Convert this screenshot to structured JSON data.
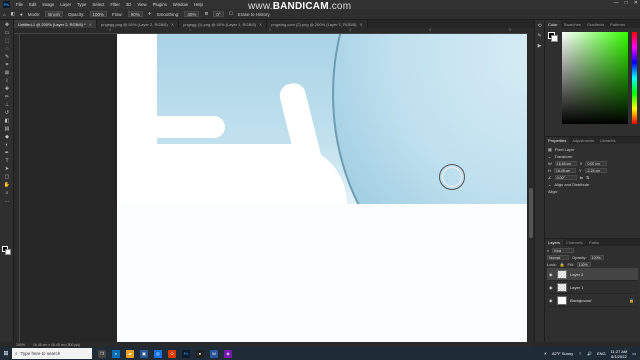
{
  "menubar": {
    "logo": "Ps",
    "items": [
      "File",
      "Edit",
      "Image",
      "Layer",
      "Type",
      "Select",
      "Filter",
      "3D",
      "View",
      "Plugins",
      "Window",
      "Help"
    ],
    "window_controls": [
      "—",
      "□",
      "✕"
    ]
  },
  "watermark": {
    "prefix": "www.",
    "brand": "BANDICAM",
    "suffix": ".com"
  },
  "options_bar": {
    "mode_label": "Mode:",
    "mode_value": "Brush",
    "opacity_label": "Opacity:",
    "opacity_value": "100%",
    "flow_label": "Flow:",
    "flow_value": "90%",
    "smoothing_label": "Smoothing:",
    "smoothing_value": "40%",
    "angle_value": "0°",
    "erase_history": "Erase to History"
  },
  "tabs": [
    {
      "label": "Untitled-1 @ 200% (Layer 2, RGB/8) *",
      "active": true
    },
    {
      "label": "pngegg.png @ 50% (Layer 2, RGB/8)",
      "active": false
    },
    {
      "label": "pngegg (1).png @ 50% (Layer 1, RGB/8)",
      "active": false
    },
    {
      "label": "pngwing.com (2).png @ 200% (Layer 1, RGB/8)",
      "active": false
    }
  ],
  "ruler_ticks": [
    "0",
    "1",
    "2",
    "3",
    "4",
    "5"
  ],
  "statusbar": {
    "zoom": "200%",
    "doc": "16.45 cm x 16.45 cm (300 ppi)"
  },
  "panels": {
    "color_tabs": [
      "Color",
      "Swatches",
      "Gradients",
      "Patterns"
    ],
    "colors": {
      "accent": "#31a8ff",
      "fg": "#000000",
      "bg": "#ffffff",
      "picker_hue": "#33ff00"
    },
    "properties_tabs": [
      "Properties",
      "Adjustments",
      "Libraries"
    ],
    "properties": {
      "layer_type": "Pixel Layer",
      "transform_title": "Transform",
      "w_label": "W",
      "w_value": "16.45 cm",
      "h_label": "H",
      "h_value": "16.45 cm",
      "x_label": "X",
      "x_value": "0.00 cm",
      "y_label": "Y",
      "y_value": "-2.24 cm",
      "angle_value": "0.00°",
      "align_title": "Align and Distribute",
      "align_sub": "Align:"
    },
    "layers_tabs": [
      "Layers",
      "Channels",
      "Paths"
    ],
    "layers": {
      "kind_label": "Kind",
      "blend_mode": "Normal",
      "opacity_label": "Opacity:",
      "opacity_value": "100%",
      "lock_label": "Lock:",
      "fill_label": "Fill:",
      "fill_value": "100%",
      "items": [
        {
          "name": "Layer 2",
          "selected": true,
          "italic": false
        },
        {
          "name": "Layer 1",
          "selected": false,
          "italic": false
        },
        {
          "name": "Background",
          "selected": false,
          "italic": true
        }
      ]
    }
  },
  "taskbar": {
    "search_placeholder": "Type here to search",
    "weather": "82°F Sunny",
    "lang": "ENG",
    "time": "11:27 AM",
    "date": "6/1/2022"
  }
}
